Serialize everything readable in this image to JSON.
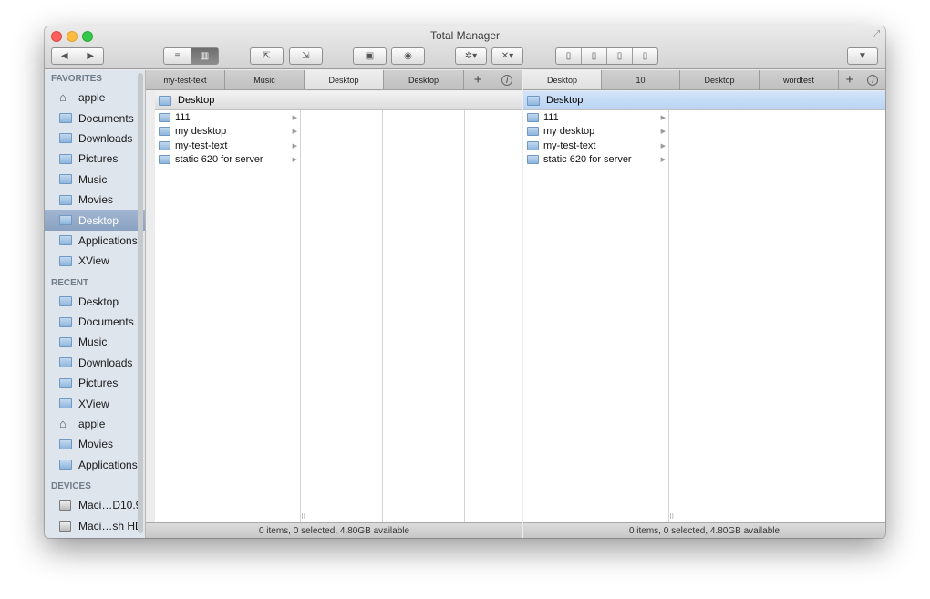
{
  "window": {
    "title": "Total Manager"
  },
  "sidebar": {
    "favorites_heading": "FAVORITES",
    "favorites": [
      {
        "label": "apple",
        "icon": "home-icon"
      },
      {
        "label": "Documents"
      },
      {
        "label": "Downloads"
      },
      {
        "label": "Pictures"
      },
      {
        "label": "Music"
      },
      {
        "label": "Movies"
      },
      {
        "label": "Desktop",
        "selected": true
      },
      {
        "label": "Applications"
      },
      {
        "label": "XView"
      }
    ],
    "recent_heading": "RECENT",
    "recent": [
      {
        "label": "Desktop"
      },
      {
        "label": "Documents"
      },
      {
        "label": "Music"
      },
      {
        "label": "Downloads"
      },
      {
        "label": "Pictures"
      },
      {
        "label": "XView"
      },
      {
        "label": "apple",
        "icon": "home-icon"
      },
      {
        "label": "Movies"
      },
      {
        "label": "Applications"
      }
    ],
    "devices_heading": "DEVICES",
    "devices": [
      {
        "label": "Maci…D10.9"
      },
      {
        "label": "Maci…sh HD"
      }
    ]
  },
  "left": {
    "tabs": [
      "my-test-text",
      "Music",
      "Desktop",
      "Desktop"
    ],
    "active_tab": 2,
    "path": "Desktop",
    "files": [
      "111",
      "my desktop",
      "my-test-text",
      "static 620 for server"
    ],
    "status": "0 items, 0 selected, 4.80GB available"
  },
  "right": {
    "tabs": [
      "Desktop",
      "10",
      "Desktop",
      "wordtest"
    ],
    "active_tab": 0,
    "path": "Desktop",
    "files": [
      "111",
      "my desktop",
      "my-test-text",
      "static 620 for server"
    ],
    "status": "0 items, 0 selected, 4.80GB available"
  },
  "icons": {
    "back": "◀",
    "forward": "▶",
    "list": "≡",
    "columns": "▥",
    "plus": "+",
    "info": "i",
    "arrow": "▶",
    "gear": "✲",
    "tools": "✕",
    "menu": "▼"
  },
  "colors": {
    "selection": "#8ba1c1",
    "pathbar_active": "#c8dcf4"
  }
}
